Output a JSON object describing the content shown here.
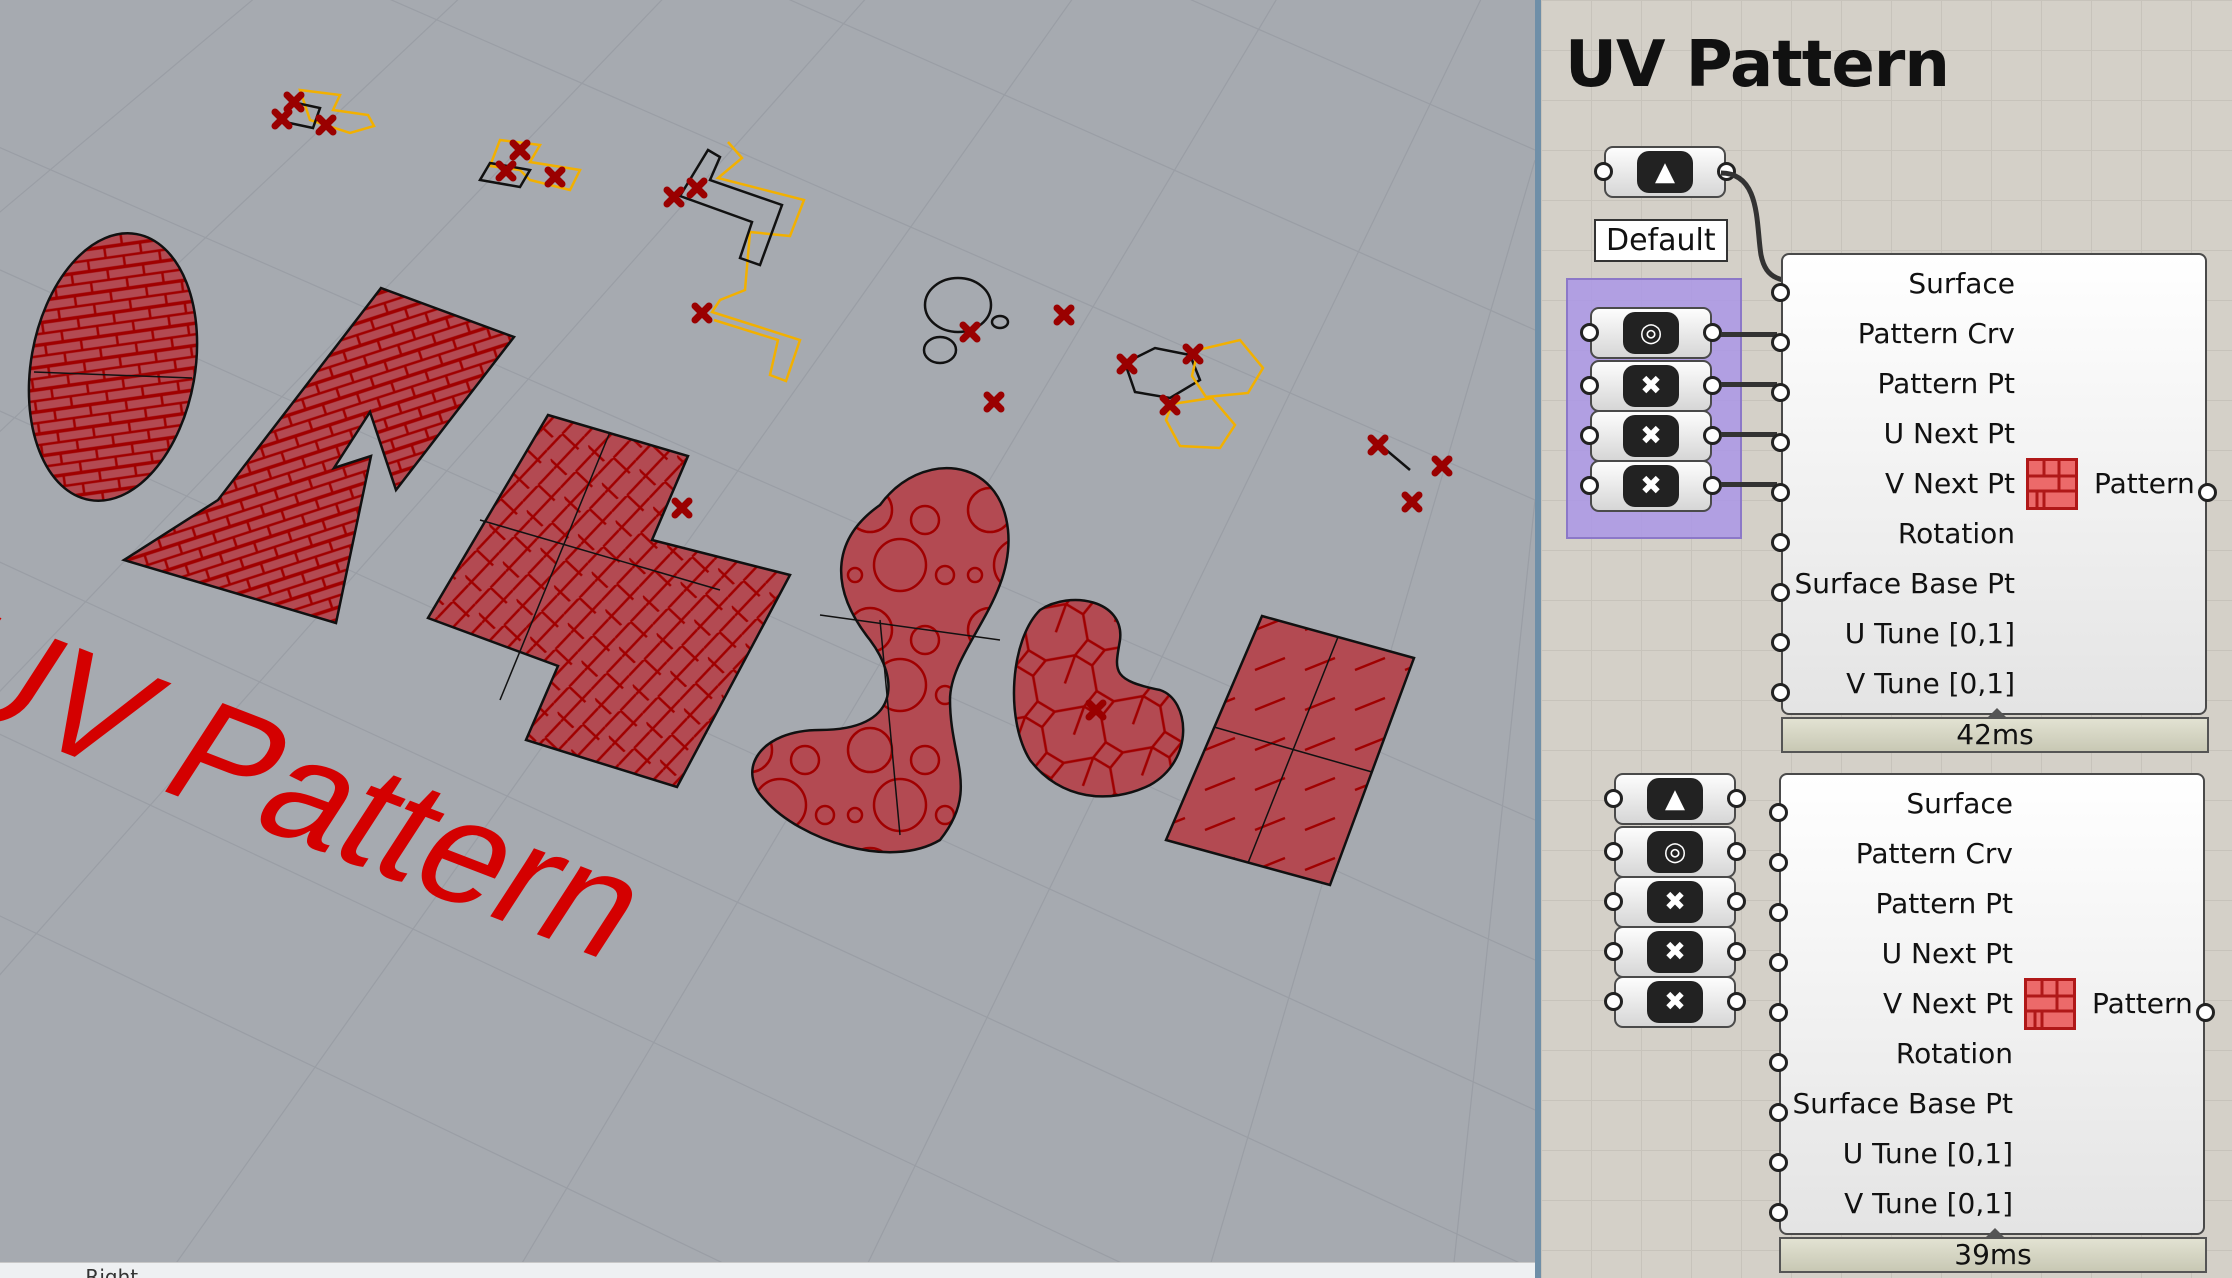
{
  "viewport": {
    "label_3d": "UV Pattern",
    "footer_text": "...  Right",
    "colors": {
      "background": "#a6aab0",
      "grid": "#9a9ea5",
      "pattern_fill": "#b34a52",
      "pattern_line": "#a00000",
      "curve": "#f2b000",
      "point": "#9a0000",
      "text": "#d40000"
    }
  },
  "canvas": {
    "title": "UV Pattern",
    "group1": {
      "tag": "Default",
      "surface_param_icon": "surface-icon",
      "params": [
        {
          "icon": "curve-spiral-icon",
          "glyph": "◎"
        },
        {
          "icon": "point-x-icon",
          "glyph": "✖"
        },
        {
          "icon": "point-x-icon",
          "glyph": "✖"
        },
        {
          "icon": "point-x-icon",
          "glyph": "✖"
        }
      ]
    },
    "component1": {
      "inputs": [
        "Surface",
        "Pattern Crv",
        "Pattern Pt",
        "U Next Pt",
        "V Next Pt",
        "Rotation",
        "Surface Base Pt",
        "U Tune [0,1]",
        "V Tune [0,1]"
      ],
      "output": "Pattern",
      "icon": "pattern-grid-icon",
      "time": "42ms"
    },
    "component2": {
      "inputs": [
        "Surface",
        "Pattern Crv",
        "Pattern Pt",
        "U Next Pt",
        "V Next Pt",
        "Rotation",
        "Surface Base Pt",
        "U Tune [0,1]",
        "V Tune [0,1]"
      ],
      "output": "Pattern",
      "icon": "pattern-grid-icon",
      "time": "39ms"
    },
    "group2_params": [
      {
        "icon": "surface-icon",
        "glyph": "▲"
      },
      {
        "icon": "curve-spiral-icon",
        "glyph": "◎"
      },
      {
        "icon": "point-x-icon",
        "glyph": "✖"
      },
      {
        "icon": "point-x-icon",
        "glyph": "✖"
      },
      {
        "icon": "point-x-icon",
        "glyph": "✖"
      }
    ]
  }
}
